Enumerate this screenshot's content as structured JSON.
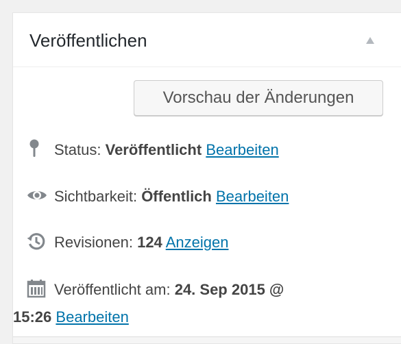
{
  "panel": {
    "title": "Veröffentlichen",
    "toggle_icon": "triangle-up-icon"
  },
  "preview_button": {
    "label": "Vorschau der Änderungen"
  },
  "status": {
    "icon": "pin-icon",
    "label": "Status:",
    "value": "Veröffentlicht",
    "link": "Bearbeiten"
  },
  "visibility": {
    "icon": "eye-icon",
    "label": "Sichtbarkeit:",
    "value": "Öffentlich",
    "link": "Bearbeiten"
  },
  "revisions": {
    "icon": "history-icon",
    "label": "Revisionen:",
    "value": "124",
    "link": "Anzeigen"
  },
  "published": {
    "icon": "calendar-icon",
    "label": "Veröffentlicht am:",
    "date": "24. Sep 2015 @",
    "time": "15:26",
    "link": "Bearbeiten"
  },
  "colors": {
    "link": "#0073aa",
    "text": "#444444",
    "background": "#f1f1f1",
    "icon": "#82878c"
  }
}
